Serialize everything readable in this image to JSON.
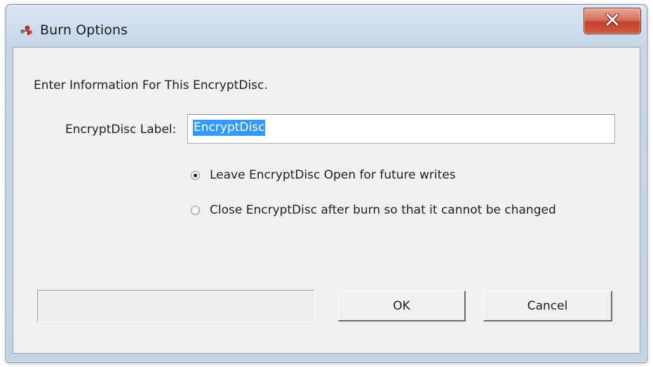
{
  "window": {
    "title": "Burn Options",
    "title_icon": "burn-disc-icon",
    "close_icon": "close-icon"
  },
  "dialog": {
    "intro": "Enter Information For This EncryptDisc.",
    "label_field": {
      "label": "EncryptDisc Label:",
      "value": "EncryptDisc",
      "selected": true
    },
    "options": [
      {
        "label": "Leave EncryptDisc Open for future writes",
        "checked": true
      },
      {
        "label": "Close EncryptDisc after burn so that it cannot be changed",
        "checked": false
      }
    ],
    "status_text": "",
    "buttons": {
      "ok": "OK",
      "cancel": "Cancel"
    }
  },
  "colors": {
    "title_gradient": "#d9e6f3",
    "client_bg": "#f0f0f0",
    "selection": "#3399ff",
    "close_red": "#c2412a"
  }
}
